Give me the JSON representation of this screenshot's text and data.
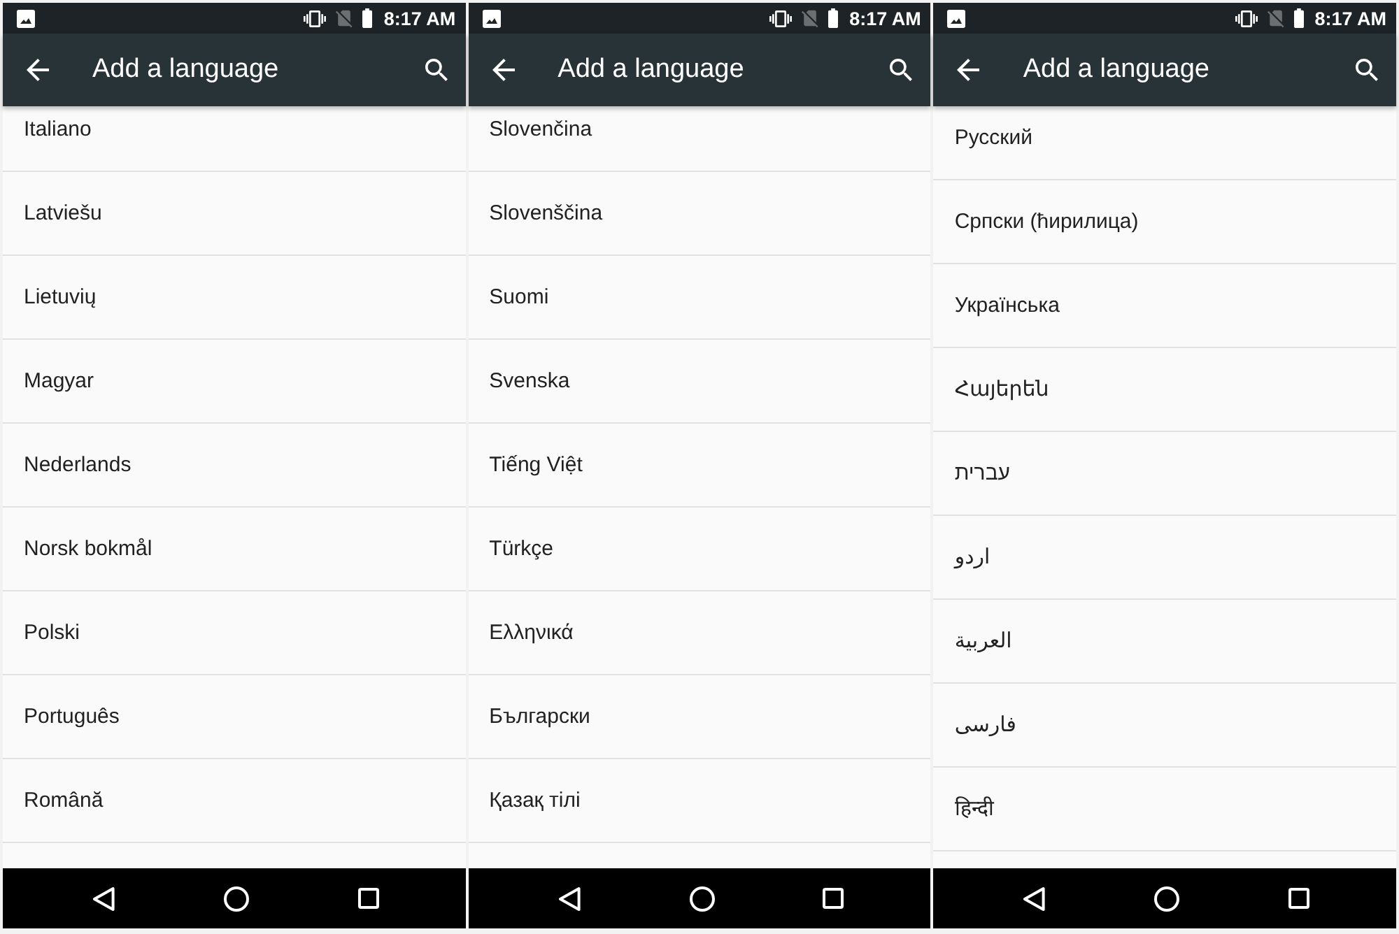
{
  "screens": [
    {
      "status_bar": {
        "time": "8:17 AM"
      },
      "toolbar": {
        "title": "Add a language"
      },
      "languages": [
        "Italiano",
        "Latviešu",
        "Lietuvių",
        "Magyar",
        "Nederlands",
        "Norsk bokmål",
        "Polski",
        "Português",
        "Română"
      ]
    },
    {
      "status_bar": {
        "time": "8:17 AM"
      },
      "toolbar": {
        "title": "Add a language"
      },
      "languages": [
        "Slovenčina",
        "Slovenščina",
        "Suomi",
        "Svenska",
        "Tiếng Việt",
        "Türkçe",
        "Ελληνικά",
        "Български",
        "Қазақ тілі"
      ]
    },
    {
      "status_bar": {
        "time": "8:17 AM"
      },
      "toolbar": {
        "title": "Add a language"
      },
      "languages": [
        "Русский",
        "Српски (ћирилица)",
        "Українська",
        "Հայերեն",
        "עברית",
        "اردو",
        "العربية",
        "فارسی",
        "हिन्दी"
      ]
    }
  ]
}
